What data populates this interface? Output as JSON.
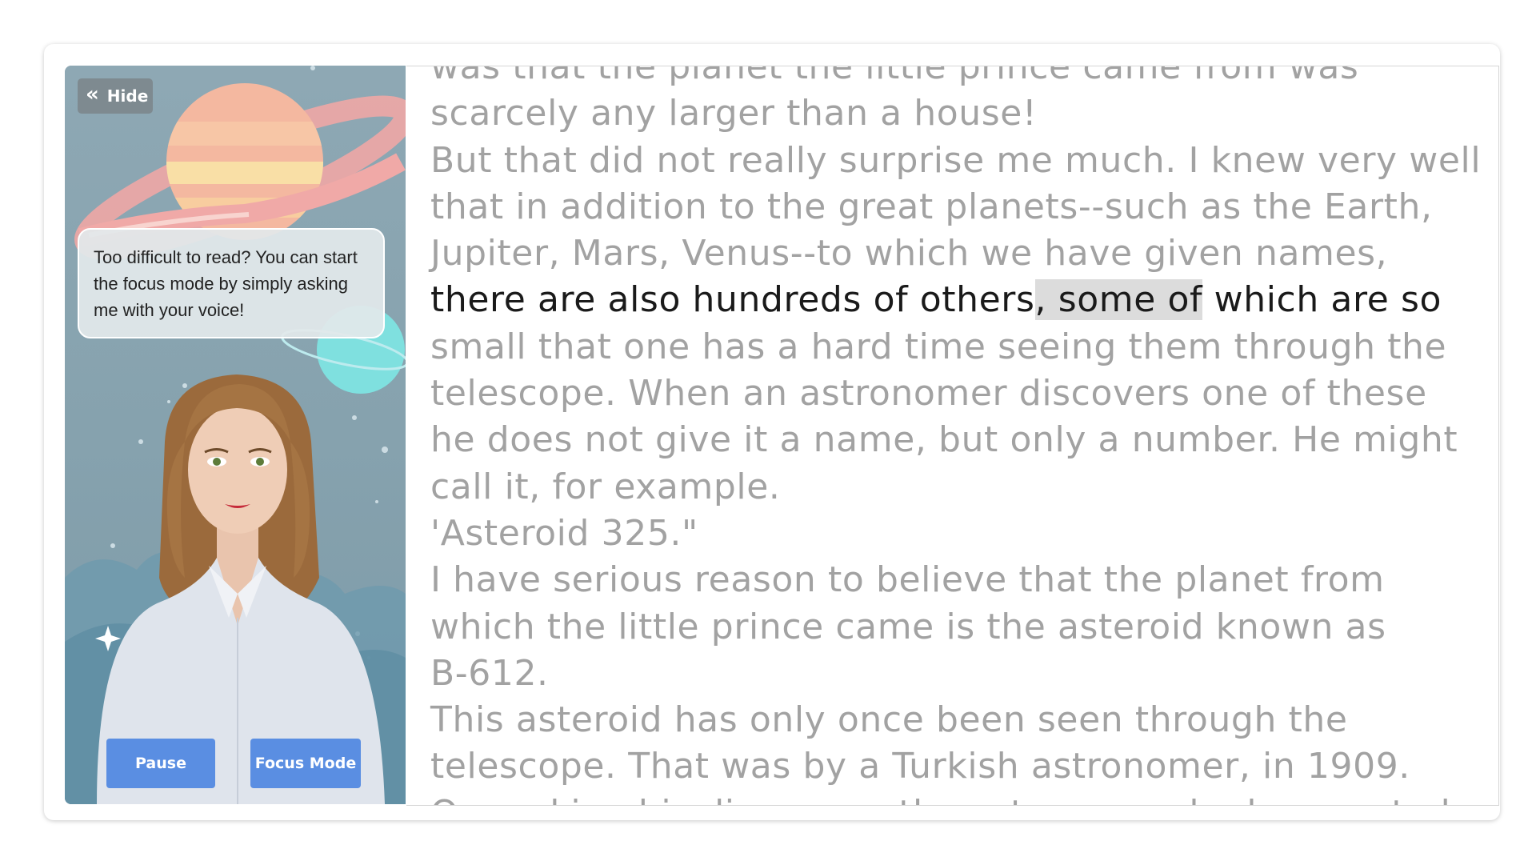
{
  "avatar_panel": {
    "hide_label": "Hide",
    "hide_icon": "double-chevron-left-icon",
    "bubble_text": "Too difficult to read? You can start the focus mode by simply asking me with your voice!",
    "pause_label": "Pause",
    "focus_label": "Focus Mode",
    "accent_color": "#5a8ee2"
  },
  "reader": {
    "lines": [
      "was that the planet the little prince came from was",
      "scarcely any larger than a house!",
      "But that did not really surprise me much. I knew very well",
      "that in addition to the great planets--such as the Earth,",
      "Jupiter, Mars, Venus--to which we have given names,"
    ],
    "current_line": {
      "before": "there are also hundreds of others",
      "highlight": ", some of",
      "after": " which are so"
    },
    "lines_after": [
      "small that one has a hard time seeing them through the",
      "telescope. When an astronomer discovers one of these",
      "he does not give it a name, but only a number. He might",
      "call it, for example.",
      "'Asteroid 325.\"",
      "I have serious reason to believe that the planet from",
      "which the little prince came is the asteroid known as",
      "B-612.",
      "This asteroid has only once been seen through the",
      "telescope. That was by a Turkish astronomer, in 1909.",
      "On making his discovery, the astronomer had presented"
    ]
  }
}
